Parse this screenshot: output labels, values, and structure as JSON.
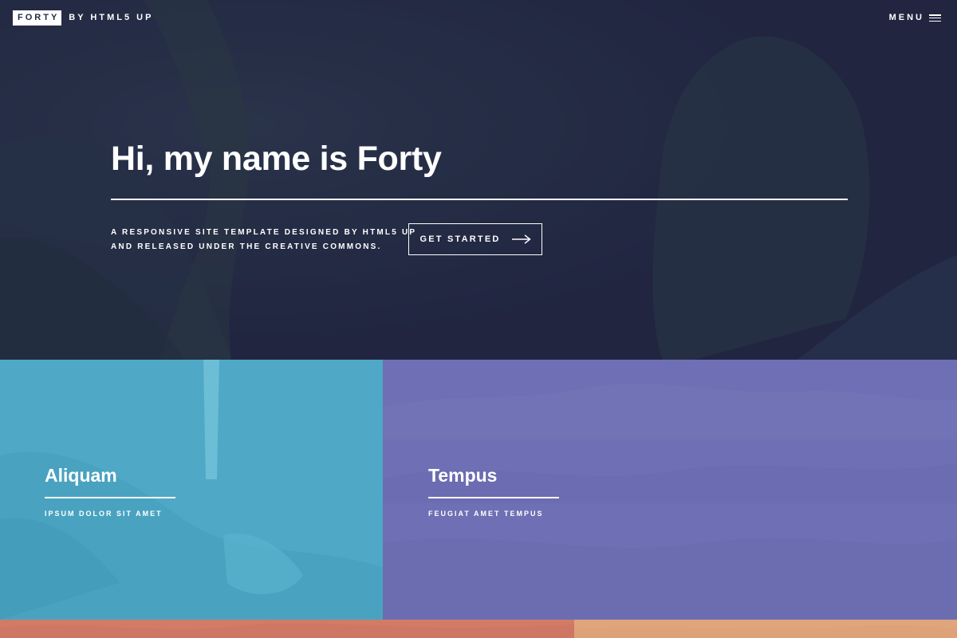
{
  "header": {
    "logo_text": "FORTY",
    "logo_sub": "BY HTML5 UP",
    "menu_label": "MENU",
    "menu_icon": "hamburger-icon"
  },
  "banner": {
    "title": "Hi, my name is Forty",
    "description_line1": "A RESPONSIVE SITE TEMPLATE DESIGNED BY HTML5 UP",
    "description_line2": "AND RELEASED UNDER THE CREATIVE COMMONS.",
    "button_label": "GET STARTED",
    "button_icon": "arrow-right-icon",
    "background_color": "#242943"
  },
  "tiles": [
    {
      "title": "Aliquam",
      "subtitle": "IPSUM DOLOR SIT AMET",
      "color": "#4fa8c5"
    },
    {
      "title": "Tempus",
      "subtitle": "FEUGIAT AMET TEMPUS",
      "color": "#6e6fb4"
    },
    {
      "title": "",
      "subtitle": "",
      "color": "#d27b67"
    },
    {
      "title": "",
      "subtitle": "",
      "color": "#e0a57b"
    }
  ]
}
